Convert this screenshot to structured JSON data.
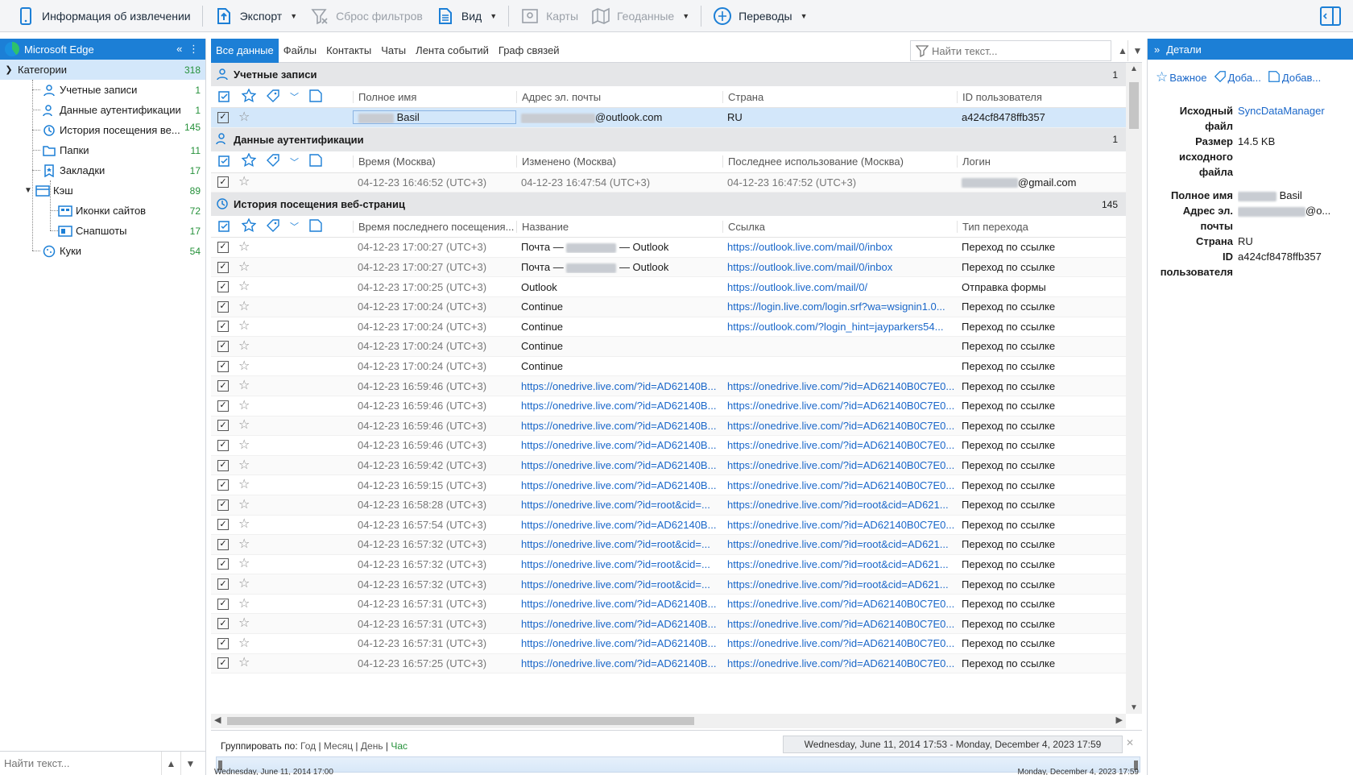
{
  "toolbar": {
    "extract_info": "Информация об извлечении",
    "export": "Экспорт",
    "reset_filters": "Сброс фильтров",
    "view": "Вид",
    "maps": "Карты",
    "geodata": "Геоданные",
    "translations": "Переводы"
  },
  "sidebar": {
    "app": "Microsoft Edge",
    "root": {
      "label": "Категории",
      "count": "318"
    },
    "items": [
      {
        "label": "Учетные записи",
        "count": "1"
      },
      {
        "label": "Данные аутентификации",
        "count": "1"
      },
      {
        "label": "История посещения ве...",
        "count": "145"
      },
      {
        "label": "Папки",
        "count": "11"
      },
      {
        "label": "Закладки",
        "count": "17"
      },
      {
        "label": "Кэш",
        "count": "89"
      },
      {
        "label": "Иконки сайтов",
        "count": "72"
      },
      {
        "label": "Снапшоты",
        "count": "17"
      },
      {
        "label": "Куки",
        "count": "54"
      }
    ],
    "search_placeholder": "Найти текст..."
  },
  "tabs": [
    "Все данные",
    "Файлы",
    "Контакты",
    "Чаты",
    "Лента событий",
    "Граф связей"
  ],
  "search_placeholder": "Найти текст...",
  "accounts": {
    "title": "Учетные записи",
    "count": "1",
    "headers": [
      "Полное имя",
      "Адрес эл. почты",
      "Страна",
      "ID пользователя"
    ],
    "row": {
      "name": "Basil",
      "email": "@outlook.com",
      "country": "RU",
      "id": "a424cf8478ffb357"
    }
  },
  "auth": {
    "title": "Данные аутентификации",
    "count": "1",
    "headers": [
      "Время (Москва)",
      "Изменено (Москва)",
      "Последнее использование (Москва)",
      "Логин"
    ],
    "row": {
      "time": "04-12-23 16:46:52 (UTC+3)",
      "modified": "04-12-23 16:47:54 (UTC+3)",
      "last_used": "04-12-23 16:47:52 (UTC+3)",
      "login": "@gmail.com"
    }
  },
  "history": {
    "title": "История посещения веб-страниц",
    "count": "145",
    "headers": [
      "Время последнего посещения...",
      "Название",
      "Ссылка",
      "Тип перехода"
    ],
    "rows": [
      {
        "time": "04-12-23 17:00:27 (UTC+3)",
        "title": "Почта — ",
        "title_suffix": " — Outlook",
        "title_blur": true,
        "title_link": false,
        "url": "https://outlook.live.com/mail/0/inbox",
        "type": "Переход по ссылке"
      },
      {
        "time": "04-12-23 17:00:27 (UTC+3)",
        "title": "Почта — ",
        "title_suffix": " — Outlook",
        "title_blur": true,
        "title_link": false,
        "url": "https://outlook.live.com/mail/0/inbox",
        "type": "Переход по ссылке"
      },
      {
        "time": "04-12-23 17:00:25 (UTC+3)",
        "title": "Outlook",
        "title_suffix": "",
        "title_blur": false,
        "title_link": false,
        "url": "https://outlook.live.com/mail/0/",
        "type": "Отправка формы"
      },
      {
        "time": "04-12-23 17:00:24 (UTC+3)",
        "title": "Continue",
        "title_suffix": "",
        "title_blur": false,
        "title_link": false,
        "url": "https://login.live.com/login.srf?wa=wsignin1.0...",
        "type": "Переход по ссылке"
      },
      {
        "time": "04-12-23 17:00:24 (UTC+3)",
        "title": "Continue",
        "title_suffix": "",
        "title_blur": false,
        "title_link": false,
        "url": "https://outlook.com/?login_hint=jayparkers54...",
        "type": "Переход по ссылке"
      },
      {
        "time": "04-12-23 17:00:24 (UTC+3)",
        "title": "Continue",
        "title_suffix": "",
        "title_blur": false,
        "title_link": false,
        "url": "",
        "type": "Переход по ссылке"
      },
      {
        "time": "04-12-23 17:00:24 (UTC+3)",
        "title": "Continue",
        "title_suffix": "",
        "title_blur": false,
        "title_link": false,
        "url": "",
        "type": "Переход по ссылке"
      },
      {
        "time": "04-12-23 16:59:46 (UTC+3)",
        "title": "https://onedrive.live.com/?id=AD62140B...",
        "title_suffix": "",
        "title_blur": false,
        "title_link": true,
        "url": "https://onedrive.live.com/?id=AD62140B0C7E0...",
        "type": "Переход по ссылке"
      },
      {
        "time": "04-12-23 16:59:46 (UTC+3)",
        "title": "https://onedrive.live.com/?id=AD62140B...",
        "title_suffix": "",
        "title_blur": false,
        "title_link": true,
        "url": "https://onedrive.live.com/?id=AD62140B0C7E0...",
        "type": "Переход по ссылке"
      },
      {
        "time": "04-12-23 16:59:46 (UTC+3)",
        "title": "https://onedrive.live.com/?id=AD62140B...",
        "title_suffix": "",
        "title_blur": false,
        "title_link": true,
        "url": "https://onedrive.live.com/?id=AD62140B0C7E0...",
        "type": "Переход по ссылке"
      },
      {
        "time": "04-12-23 16:59:46 (UTC+3)",
        "title": "https://onedrive.live.com/?id=AD62140B...",
        "title_suffix": "",
        "title_blur": false,
        "title_link": true,
        "url": "https://onedrive.live.com/?id=AD62140B0C7E0...",
        "type": "Переход по ссылке"
      },
      {
        "time": "04-12-23 16:59:42 (UTC+3)",
        "title": "https://onedrive.live.com/?id=AD62140B...",
        "title_suffix": "",
        "title_blur": false,
        "title_link": true,
        "url": "https://onedrive.live.com/?id=AD62140B0C7E0...",
        "type": "Переход по ссылке"
      },
      {
        "time": "04-12-23 16:59:15 (UTC+3)",
        "title": "https://onedrive.live.com/?id=AD62140B...",
        "title_suffix": "",
        "title_blur": false,
        "title_link": true,
        "url": "https://onedrive.live.com/?id=AD62140B0C7E0...",
        "type": "Переход по ссылке"
      },
      {
        "time": "04-12-23 16:58:28 (UTC+3)",
        "title": "https://onedrive.live.com/?id=root&cid=...",
        "title_suffix": "",
        "title_blur": false,
        "title_link": true,
        "url": "https://onedrive.live.com/?id=root&cid=AD621...",
        "type": "Переход по ссылке"
      },
      {
        "time": "04-12-23 16:57:54 (UTC+3)",
        "title": "https://onedrive.live.com/?id=AD62140B...",
        "title_suffix": "",
        "title_blur": false,
        "title_link": true,
        "url": "https://onedrive.live.com/?id=AD62140B0C7E0...",
        "type": "Переход по ссылке"
      },
      {
        "time": "04-12-23 16:57:32 (UTC+3)",
        "title": "https://onedrive.live.com/?id=root&cid=...",
        "title_suffix": "",
        "title_blur": false,
        "title_link": true,
        "url": "https://onedrive.live.com/?id=root&cid=AD621...",
        "type": "Переход по ссылке"
      },
      {
        "time": "04-12-23 16:57:32 (UTC+3)",
        "title": "https://onedrive.live.com/?id=root&cid=...",
        "title_suffix": "",
        "title_blur": false,
        "title_link": true,
        "url": "https://onedrive.live.com/?id=root&cid=AD621...",
        "type": "Переход по ссылке"
      },
      {
        "time": "04-12-23 16:57:32 (UTC+3)",
        "title": "https://onedrive.live.com/?id=root&cid=...",
        "title_suffix": "",
        "title_blur": false,
        "title_link": true,
        "url": "https://onedrive.live.com/?id=root&cid=AD621...",
        "type": "Переход по ссылке"
      },
      {
        "time": "04-12-23 16:57:31 (UTC+3)",
        "title": "https://onedrive.live.com/?id=AD62140B...",
        "title_suffix": "",
        "title_blur": false,
        "title_link": true,
        "url": "https://onedrive.live.com/?id=AD62140B0C7E0...",
        "type": "Переход по ссылке"
      },
      {
        "time": "04-12-23 16:57:31 (UTC+3)",
        "title": "https://onedrive.live.com/?id=AD62140B...",
        "title_suffix": "",
        "title_blur": false,
        "title_link": true,
        "url": "https://onedrive.live.com/?id=AD62140B0C7E0...",
        "type": "Переход по ссылке"
      },
      {
        "time": "04-12-23 16:57:31 (UTC+3)",
        "title": "https://onedrive.live.com/?id=AD62140B...",
        "title_suffix": "",
        "title_blur": false,
        "title_link": true,
        "url": "https://onedrive.live.com/?id=AD62140B0C7E0...",
        "type": "Переход по ссылке"
      },
      {
        "time": "04-12-23 16:57:25 (UTC+3)",
        "title": "https://onedrive.live.com/?id=AD62140B...",
        "title_suffix": "",
        "title_blur": false,
        "title_link": true,
        "url": "https://onedrive.live.com/?id=AD62140B0C7E0...",
        "type": "Переход по ссылке"
      }
    ]
  },
  "timeline": {
    "group_by": "Группировать по:",
    "options": [
      "Год",
      "Месяц",
      "День",
      "Час"
    ],
    "active": "Час",
    "range": "Wednesday, June 11, 2014 17:53 - Monday, December 4, 2023 17:59",
    "start_label": "Wednesday, June 11, 2014 17:00",
    "end_label": "Monday, December 4, 2023 17:59"
  },
  "details": {
    "title": "Детали",
    "actions": [
      "Важное",
      "Доба...",
      "Добав..."
    ],
    "fields": [
      {
        "k": "Исходный файл",
        "v": "SyncDataManager",
        "link": true
      },
      {
        "k": "Размер исходного файла",
        "v": "14.5 KB",
        "link": false
      },
      {
        "k": "Полное имя",
        "v": "Basil",
        "link": false,
        "blur": true
      },
      {
        "k": "Адрес эл. почты",
        "v": "@o...",
        "link": false,
        "blur": true
      },
      {
        "k": "Страна",
        "v": "RU",
        "link": false
      },
      {
        "k": "ID пользователя",
        "v": "a424cf8478ffb357",
        "link": false
      }
    ]
  },
  "colors": {
    "accent": "#1c7fd6",
    "link": "#1a67c9",
    "count": "#25913a",
    "selected": "#d3e7fa"
  }
}
